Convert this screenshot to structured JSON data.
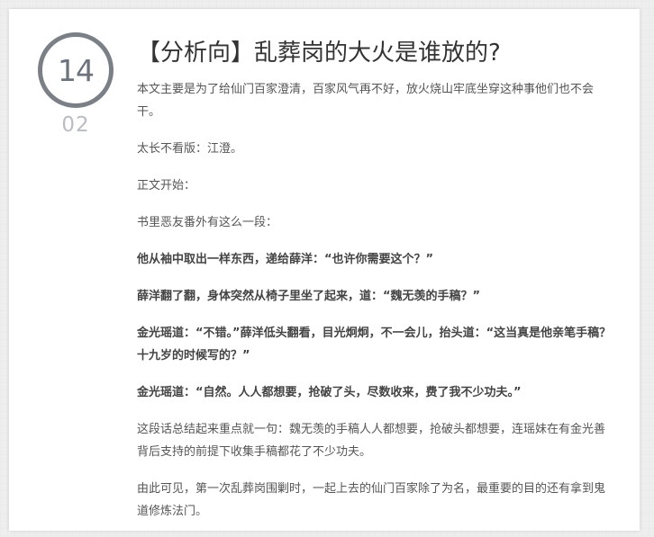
{
  "date": {
    "day": "14",
    "month": "02"
  },
  "post": {
    "title": "【分析向】乱葬岗的大火是谁放的?",
    "paragraphs": [
      {
        "text": "本文主要是为了给仙门百家澄清，百家风气再不好，放火烧山牢底坐穿这种事他们也不会干。",
        "bold": false
      },
      {
        "text": "太长不看版：江澄。",
        "bold": false
      },
      {
        "text": "正文开始：",
        "bold": false
      },
      {
        "text": "书里恶友番外有这么一段：",
        "bold": false
      },
      {
        "text": "他从袖中取出一样东西，递给薛洋：“也许你需要这个？”",
        "bold": true
      },
      {
        "text": "薛洋翻了翻，身体突然从椅子里坐了起来，道：“魏无羡的手稿？”",
        "bold": true
      },
      {
        "text": "金光瑶道：“不错。”薛洋低头翻看，目光炯炯，不一会儿，抬头道：“这当真是他亲笔手稿？十九岁的时候写的？”",
        "bold": true
      },
      {
        "text": "金光瑶道：“自然。人人都想要，抢破了头，尽数收来，费了我不少功夫。”",
        "bold": true
      },
      {
        "text": "这段话总结起来重点就一句：魏无羡的手稿人人都想要，抢破头都想要，连瑶妹在有金光善背后支持的前提下收集手稿都花了不少功夫。",
        "bold": false
      },
      {
        "text": "由此可见，第一次乱葬岗围剿时，一起上去的仙门百家除了为名，最重要的目的还有拿到鬼道修炼法门。",
        "bold": false
      }
    ]
  }
}
